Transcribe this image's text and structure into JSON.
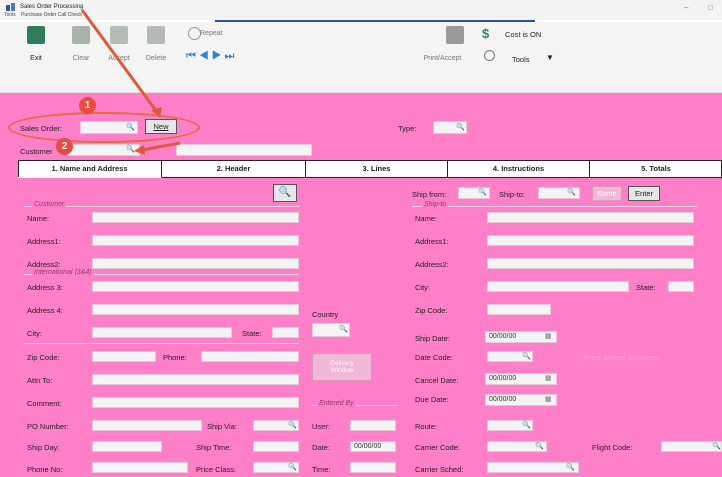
{
  "window": {
    "title": "Sales Order Processing",
    "menu": [
      "Tools",
      "Purchase Order Call Check"
    ],
    "minimize": "–",
    "maximize": "□"
  },
  "toolbar": {
    "exit": "Exit",
    "clear": "Clear",
    "accept": "Accept",
    "delete": "Delete",
    "repeat": "Repeat",
    "print_accept": "Print/Accept",
    "cost": "Cost is ON",
    "tools": "Tools"
  },
  "header": {
    "sales_order_label": "Sales Order:",
    "new_button": "New",
    "type_label": "Type:",
    "customer_label": "Customer"
  },
  "annotations": {
    "step1": "1",
    "step2": "2"
  },
  "tabs": [
    "1. Name and Address",
    "2. Header",
    "3. Lines",
    "4. Instructions",
    "5. Totals"
  ],
  "left": {
    "customer_section": "Customer",
    "name": "Name:",
    "address1": "Address1:",
    "address2": "Address2:",
    "international_section": "International (3&4)",
    "address3": "Address 3:",
    "address4": "Address 4:",
    "city": "City:",
    "state": "State:",
    "zip": "Zip Code:",
    "phone": "Phone:",
    "attn": "Attn To:",
    "comment": "Comment:",
    "po_number": "PO Number:",
    "ship_via": "Ship Via:",
    "ship_day": "Ship Day:",
    "ship_time": "Ship Time:",
    "phone_no": "Phone No:",
    "price_class": "Price Class:"
  },
  "middle": {
    "country": "Country",
    "delivery_window": [
      "Delivery",
      "Window"
    ],
    "entered_by_section": "Entered By",
    "user": "User:",
    "date": "Date:",
    "date_value": "00/00/00",
    "time": "Time:"
  },
  "right": {
    "ship_from": "Ship from:",
    "ship_to": "Ship-to:",
    "same_button": "Same",
    "enter_button": "Enter",
    "shipto_section": "Ship-to",
    "name": "Name:",
    "address1": "Address1:",
    "address2": "Address2:",
    "city": "City:",
    "state": "State:",
    "zip": "Zip Code:",
    "ship_date": "Ship Date:",
    "ship_date_value": "00/00/00",
    "date_code": "Date Code:",
    "price_before": "Price Before Shipment",
    "cancel_date": "Cancel Date:",
    "cancel_date_value": "00/00/00",
    "due_date": "Due Date:",
    "due_date_value": "00/00/00",
    "route": "Route:",
    "carrier_code": "Carrier Code:",
    "flight_code": "Flight Code:",
    "carrier_sched": "Carrier Sched:"
  },
  "icons": {
    "search": "🔍",
    "calendar": "▦"
  },
  "colors": {
    "form_background": "#ff80c8",
    "annotation": "#e74c3c"
  }
}
